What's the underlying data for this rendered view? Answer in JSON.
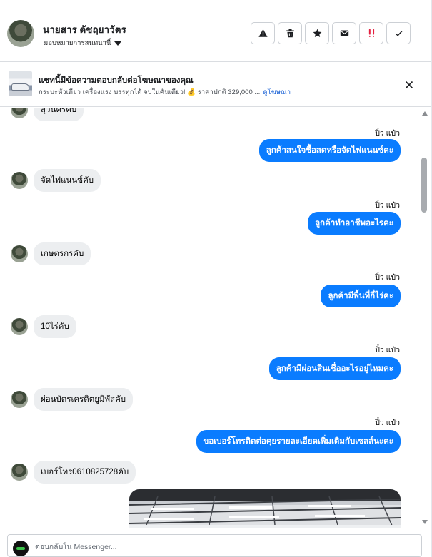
{
  "contact": {
    "name": "นายสาร ดัชฤยาวัตร",
    "assign_label": "มอบหมายการสนทนานี้"
  },
  "actions": [
    {
      "name": "report-spam-icon"
    },
    {
      "name": "trash-icon"
    },
    {
      "name": "star-icon"
    },
    {
      "name": "mail-icon"
    },
    {
      "name": "follow-up-icon"
    },
    {
      "name": "check-icon"
    }
  ],
  "ad_banner": {
    "title": "แชทนี้มีข้อความตอบกลับต่อโฆษณาของคุณ",
    "text": "กระบะหัวเดียว เครื่องแรง บรรทุกได้ จบในคันเดียว! 💰 ราคาปกติ 329,000 ...",
    "link": "ดูโฆษณา"
  },
  "messages": [
    {
      "dir": "in",
      "text": "สุวนิครคับ"
    },
    {
      "dir": "out",
      "sender": "ปิ๋ว แป๋ว",
      "text": "ลูกค้าสนใจซื้อสดหรือจัดไฟแนนซ์คะ"
    },
    {
      "dir": "in",
      "text": "จัดไฟแนนซ์คับ"
    },
    {
      "dir": "out",
      "sender": "ปิ๋ว แป๋ว",
      "text": "ลูกค้าทำอาชีพอะไรคะ"
    },
    {
      "dir": "in",
      "text": "เกษตรกรคับ"
    },
    {
      "dir": "out",
      "sender": "ปิ๋ว แป๋ว",
      "text": "ลูกค้ามีพื้นที่กี่ไร่คะ"
    },
    {
      "dir": "in",
      "text": "10ไร่คับ"
    },
    {
      "dir": "out",
      "sender": "ปิ๋ว แป๋ว",
      "text": "ลูกค้ามีผ่อนสินเชื่ออะไรอยู่ไหมคะ"
    },
    {
      "dir": "in",
      "text": "ผ่อนบัตรเครดิตยูมิพัสคับ"
    },
    {
      "dir": "out",
      "sender": "ปิ๋ว แป๋ว",
      "text": "ขอเบอร์โทรติดต่อคุยรายละเอียดเพิ่มเติมกับเซลล์นะคะ"
    },
    {
      "dir": "in",
      "text": "เบอร์โทร0610825728คับ"
    }
  ],
  "composer": {
    "placeholder": "ตอบกลับใน Messenger..."
  }
}
